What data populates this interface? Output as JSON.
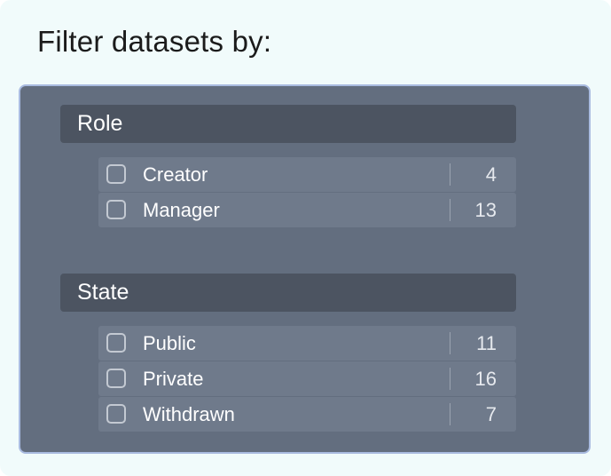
{
  "title": "Filter datasets by:",
  "groups": [
    {
      "label": "Role",
      "items": [
        {
          "label": "Creator",
          "count": "4",
          "checked": false
        },
        {
          "label": "Manager",
          "count": "13",
          "checked": false
        }
      ]
    },
    {
      "label": "State",
      "items": [
        {
          "label": "Public",
          "count": "11",
          "checked": false
        },
        {
          "label": "Private",
          "count": "16",
          "checked": false
        },
        {
          "label": "Withdrawn",
          "count": "7",
          "checked": false
        }
      ]
    }
  ],
  "colors": {
    "page_bg": "#f1fbfb",
    "panel_bg": "#636e7f",
    "panel_border": "#a9bbe0",
    "header_bg": "#4c5461",
    "item_bg": "#6f7a8b"
  }
}
